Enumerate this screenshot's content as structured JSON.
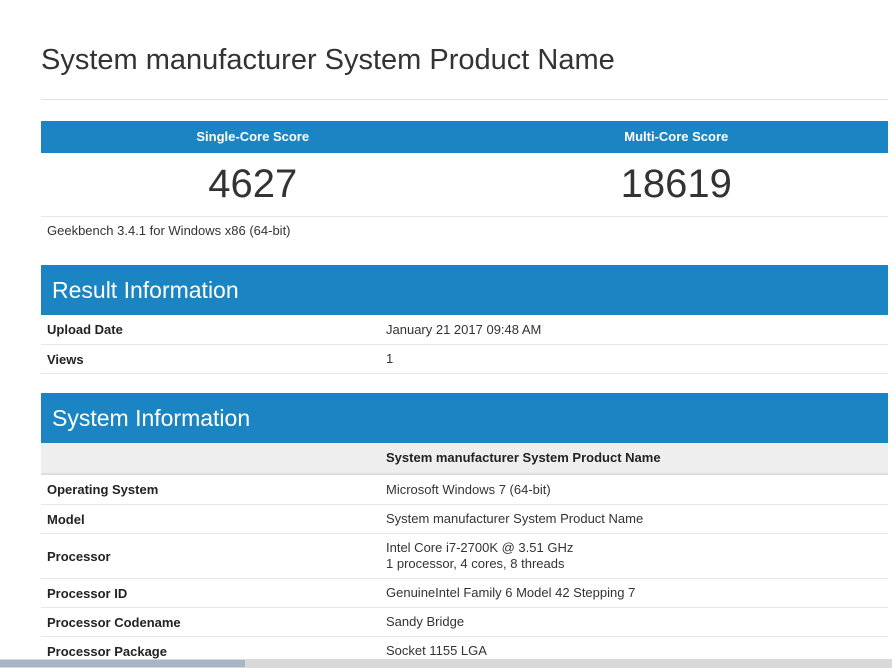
{
  "page": {
    "title": "System manufacturer System Product Name"
  },
  "scores": {
    "single_label": "Single-Core Score",
    "multi_label": "Multi-Core Score",
    "single_value": "4627",
    "multi_value": "18619",
    "version": "Geekbench 3.4.1 for Windows x86 (64-bit)"
  },
  "result_info": {
    "heading": "Result Information",
    "rows": [
      {
        "key": "Upload Date",
        "value": "January 21 2017 09:48 AM"
      },
      {
        "key": "Views",
        "value": "1"
      }
    ]
  },
  "system_info": {
    "heading": "System Information",
    "column_header": "System manufacturer System Product Name",
    "rows": [
      {
        "key": "Operating System",
        "value": "Microsoft Windows 7 (64-bit)"
      },
      {
        "key": "Model",
        "value": "System manufacturer System Product Name"
      },
      {
        "key": "Processor",
        "value": "Intel Core i7-2700K @ 3.51 GHz",
        "value2": "1 processor, 4 cores, 8 threads"
      },
      {
        "key": "Processor ID",
        "value": "GenuineIntel Family 6 Model 42 Stepping 7"
      },
      {
        "key": "Processor Codename",
        "value": "Sandy Bridge"
      },
      {
        "key": "Processor Package",
        "value": "Socket 1155 LGA"
      }
    ]
  },
  "colors": {
    "accent": "#1b85c4"
  }
}
